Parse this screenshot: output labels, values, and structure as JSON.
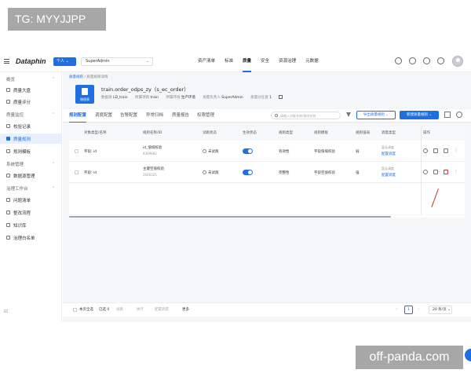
{
  "watermarks": {
    "top_left": "TG: MYYJJPP",
    "bottom_right": "off-panda.com"
  },
  "topbar": {
    "brand": "Dataphin",
    "personal_label": "个人 ⌄",
    "workspace": "SuperAdmin",
    "nav": [
      "资产清单",
      "标准",
      "质量",
      "安全",
      "资源治理",
      "元数据"
    ],
    "active_nav": "质量"
  },
  "sidebar": {
    "groups": [
      {
        "label": "概览",
        "items": [
          "质量大盘",
          "质量评分"
        ]
      },
      {
        "label": "质量监控",
        "items": [
          "校验记录",
          "质量规则",
          "规则模板"
        ]
      },
      {
        "label": "系统管理",
        "items": [
          "数据源管理"
        ]
      },
      {
        "label": "治理工作台",
        "items": [
          "问题清单",
          "整改流程",
          "知识库",
          "治理白名单"
        ]
      }
    ],
    "active_item": "质量规则",
    "collapse_icon": "⊟"
  },
  "breadcrumb": {
    "parent": "质量规则",
    "separator": "/",
    "current": "质量规则详情"
  },
  "header": {
    "icon_tag": "物理表",
    "title": "train.order_odps_zy（s_ec_order）",
    "meta": [
      {
        "k": "数据源",
        "v": "LD_train"
      },
      {
        "k": "所属项目",
        "v": "train"
      },
      {
        "k": "所属环境",
        "v": "生产环境"
      },
      {
        "k": "质量负责人",
        "v": "SuperAdmin"
      },
      {
        "k": "质量分任意",
        "v": "1"
      }
    ]
  },
  "tabs": [
    "规则配置",
    "调度配置",
    "告警配置",
    "异常归档",
    "质量报告",
    "权限管理"
  ],
  "active_tab": "规则配置",
  "toolbar": {
    "search_placeholder": "请输入对象名称/规则名称",
    "export_label": "导出质量规则 ⌄",
    "new_label": "新建质量规则 ⌄"
  },
  "table": {
    "columns": [
      "对象类型/名称",
      "规则名称/ID",
      "试跑状态",
      "生效状态",
      "规则类型",
      "规则模板",
      "规则强弱",
      "调度类型",
      "操作"
    ],
    "rows": [
      {
        "object": "字段: id",
        "rule_name": "id_值域校验",
        "rule_id": "4349982",
        "run_status": "未试跑",
        "enabled": true,
        "rule_type": "有效性",
        "template": "字段值域校验",
        "strength": "弱",
        "schedule_a": "暂无调度",
        "schedule_b": "配置调度"
      },
      {
        "object": "字段: id",
        "rule_name": "主键空值校验",
        "rule_id": "2646325",
        "run_status": "未试跑",
        "enabled": true,
        "rule_type": "完整性",
        "template": "字段空值校验",
        "strength": "强",
        "schedule_a": "暂无调度",
        "schedule_b": "配置调度"
      }
    ]
  },
  "footer": {
    "select_page": "本页全选",
    "selected": "已选 0",
    "actions": [
      "试跑",
      "执行",
      "配置调度",
      "更多"
    ],
    "page": "1",
    "page_size": "20 条/页 ⌄"
  },
  "colors": {
    "accent": "#1f6fe0",
    "delete": "#c0392b"
  }
}
